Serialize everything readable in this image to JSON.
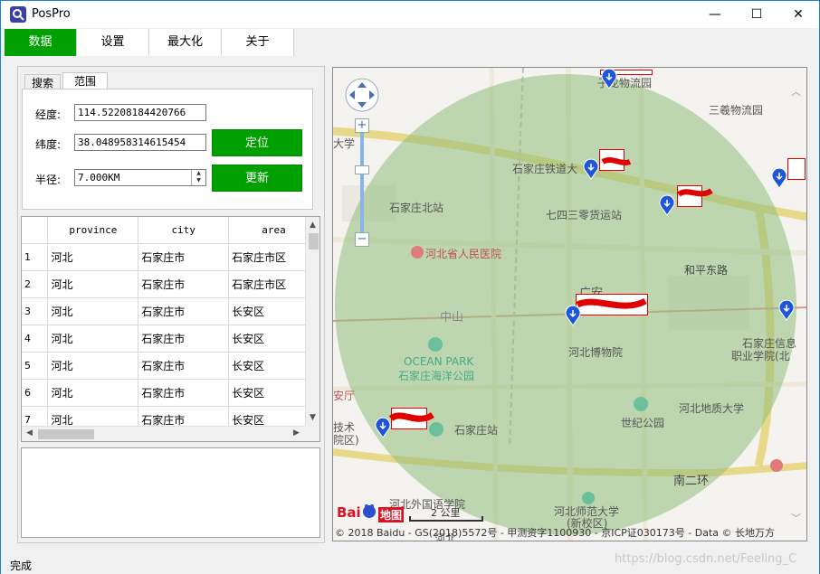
{
  "window": {
    "title": "PosPro",
    "minimize": "—",
    "maximize": "☐",
    "close": "✕"
  },
  "menu": {
    "items": [
      "数据",
      "设置",
      "最大化",
      "关于"
    ],
    "active": 0
  },
  "tabs": {
    "search": "搜索",
    "range": "范围"
  },
  "form": {
    "lng_label": "经度:",
    "lng_value": "114.52208184420766",
    "lat_label": "纬度:",
    "lat_value": "38.048958314615454",
    "radius_label": "半径:",
    "radius_value": "7.000KM",
    "locate_btn": "定位",
    "update_btn": "更新"
  },
  "table": {
    "columns": [
      "province",
      "city",
      "area"
    ],
    "rows": [
      {
        "no": "1",
        "province": "河北",
        "city": "石家庄市",
        "area": "石家庄市区"
      },
      {
        "no": "2",
        "province": "河北",
        "city": "石家庄市",
        "area": "石家庄市区"
      },
      {
        "no": "3",
        "province": "河北",
        "city": "石家庄市",
        "area": "长安区"
      },
      {
        "no": "4",
        "province": "河北",
        "city": "石家庄市",
        "area": "长安区"
      },
      {
        "no": "5",
        "province": "河北",
        "city": "石家庄市",
        "area": "长安区"
      },
      {
        "no": "6",
        "province": "河北",
        "city": "石家庄市",
        "area": "长安区"
      },
      {
        "no": "7",
        "province": "河北",
        "city": "石家庄市",
        "area": "长安区"
      }
    ]
  },
  "map": {
    "labels": {
      "logistics_park": "子龙物流园",
      "sanyi": "三羲物流园",
      "railway_univ": "石家庄铁道大",
      "daxue": "大学",
      "north_station": "石家庄北站",
      "warehouse": "七四三零货运站",
      "hospital": "河北省人民医院",
      "heping_east": "和平东路",
      "guangan": "广安",
      "zhongshan": "中山",
      "museum": "河北博物院",
      "info_college_1": "石家庄信息",
      "info_college_2": "职业学院(北",
      "ocean_park_en": "OCEAN PARK",
      "ocean_park_cn": "石家庄海洋公园",
      "anting": "安厅",
      "tech_1": "技术",
      "tech_2": "院区)",
      "sjz_station": "石家庄站",
      "century_park": "世纪公园",
      "geo_univ": "河北地质大学",
      "ring2": "南二环",
      "foreign_lang": "河北外国语学院",
      "normal_univ_1": "河北师范大学",
      "normal_univ_2": "(新校区)",
      "hebei_bottom": "河北"
    },
    "scale_label": "2 公里",
    "copyright": "© 2018 Baidu - GS(2018)5572号 - 甲测资字1100930 - 京ICP证030173号 - Data © 长地万方",
    "logo_text": "地图",
    "circle_color": "#8fbd7a",
    "marker_color": "#1f55d8"
  },
  "status": {
    "text": "完成"
  },
  "watermark": "https://blog.csdn.net/Feeling_C"
}
